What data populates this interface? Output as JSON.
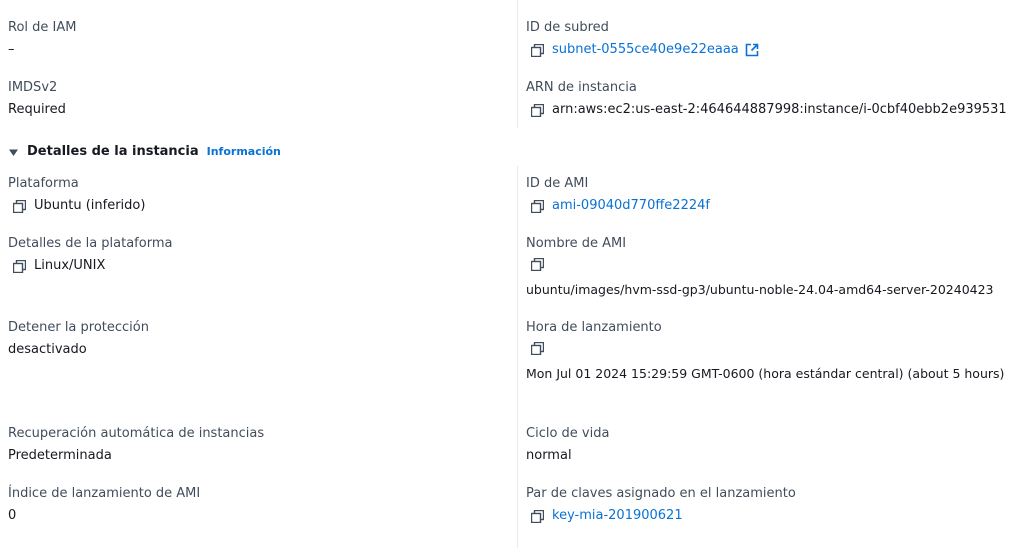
{
  "top": {
    "iam_role": {
      "label": "Rol de IAM",
      "value": "–"
    },
    "imdsv2": {
      "label": "IMDSv2",
      "value": "Required"
    },
    "subnet_id": {
      "label": "ID de subred",
      "value": "subnet-0555ce40e9e22eaaa"
    },
    "instance_arn": {
      "label": "ARN de instancia",
      "value": "arn:aws:ec2:us-east-2:464644887998:instance/i-0cbf40ebb2e939531"
    }
  },
  "section": {
    "title": "Detalles de la instancia",
    "info_link": "Información"
  },
  "left": {
    "platform": {
      "label": "Plataforma",
      "value": "Ubuntu (inferido)"
    },
    "platform_details": {
      "label": "Detalles de la plataforma",
      "value": "Linux/UNIX"
    },
    "stop_protection": {
      "label": "Detener la protección",
      "value": "desactivado"
    },
    "auto_recovery": {
      "label": "Recuperación automática de instancias",
      "value": "Predeterminada"
    },
    "ami_launch_index": {
      "label": "Índice de lanzamiento de AMI",
      "value": "0"
    }
  },
  "right": {
    "ami_id": {
      "label": "ID de AMI",
      "value": "ami-09040d770ffe2224f"
    },
    "ami_name": {
      "label": "Nombre de AMI",
      "value": "ubuntu/images/hvm-ssd-gp3/ubuntu-noble-24.04-amd64-server-20240423"
    },
    "launch_time": {
      "label": "Hora de lanzamiento",
      "value": "Mon Jul 01 2024 15:29:59 GMT-0600 (hora estándar central) (about 5 hours)"
    },
    "lifecycle": {
      "label": "Ciclo de vida",
      "value": "normal"
    },
    "key_pair": {
      "label": "Par de claves asignado en el lanzamiento",
      "value": "key-mia-201900621"
    }
  },
  "colors": {
    "link": "#0972d3",
    "label": "#414d5c",
    "text": "#16191f",
    "divider": "#e9ebed"
  },
  "icons": {
    "copy": "copy-icon",
    "external": "external-link-icon",
    "caret": "caret-down-icon"
  }
}
